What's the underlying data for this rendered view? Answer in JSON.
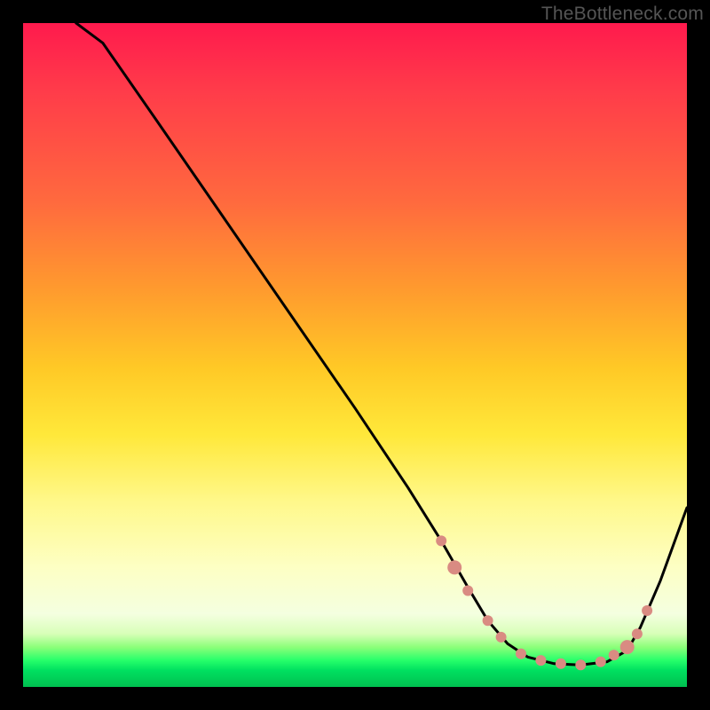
{
  "watermark": "TheBottleneck.com",
  "chart_data": {
    "type": "line",
    "title": "",
    "xlabel": "",
    "ylabel": "",
    "xlim": [
      0,
      100
    ],
    "ylim": [
      0,
      100
    ],
    "note": "Axes are unlabeled in the source image; x/y are normalized 0–100 to the plot area. y=0 is the bottom (green), y=100 is the top (red).",
    "series": [
      {
        "name": "curve",
        "x": [
          8,
          12,
          20,
          30,
          40,
          50,
          58,
          63,
          67,
          70,
          73,
          76,
          80,
          84,
          88,
          91,
          93,
          96,
          100
        ],
        "y": [
          100,
          97,
          85.5,
          71,
          56.5,
          42,
          30,
          22,
          15,
          10,
          6.5,
          4.5,
          3.5,
          3.3,
          3.8,
          5.5,
          9,
          16,
          27
        ]
      }
    ],
    "markers": {
      "name": "dots-on-curve",
      "color": "#d98b82",
      "points": [
        {
          "x": 63,
          "y": 22,
          "r": 6
        },
        {
          "x": 65,
          "y": 18,
          "r": 8
        },
        {
          "x": 67,
          "y": 14.5,
          "r": 6
        },
        {
          "x": 70,
          "y": 10,
          "r": 6
        },
        {
          "x": 72,
          "y": 7.5,
          "r": 6
        },
        {
          "x": 75,
          "y": 5,
          "r": 6
        },
        {
          "x": 78,
          "y": 4,
          "r": 6
        },
        {
          "x": 81,
          "y": 3.5,
          "r": 6
        },
        {
          "x": 84,
          "y": 3.3,
          "r": 6
        },
        {
          "x": 87,
          "y": 3.8,
          "r": 6
        },
        {
          "x": 89,
          "y": 4.8,
          "r": 6
        },
        {
          "x": 91,
          "y": 6,
          "r": 8
        },
        {
          "x": 92.5,
          "y": 8,
          "r": 6
        },
        {
          "x": 94,
          "y": 11.5,
          "r": 6
        }
      ]
    },
    "gradient_stops": [
      {
        "pos": 0,
        "color": "#ff1a4d"
      },
      {
        "pos": 0.27,
        "color": "#ff6a3e"
      },
      {
        "pos": 0.52,
        "color": "#ffc926"
      },
      {
        "pos": 0.72,
        "color": "#fff88a"
      },
      {
        "pos": 0.92,
        "color": "#d8ffb8"
      },
      {
        "pos": 0.96,
        "color": "#26ff6a"
      },
      {
        "pos": 1.0,
        "color": "#00c050"
      }
    ]
  }
}
